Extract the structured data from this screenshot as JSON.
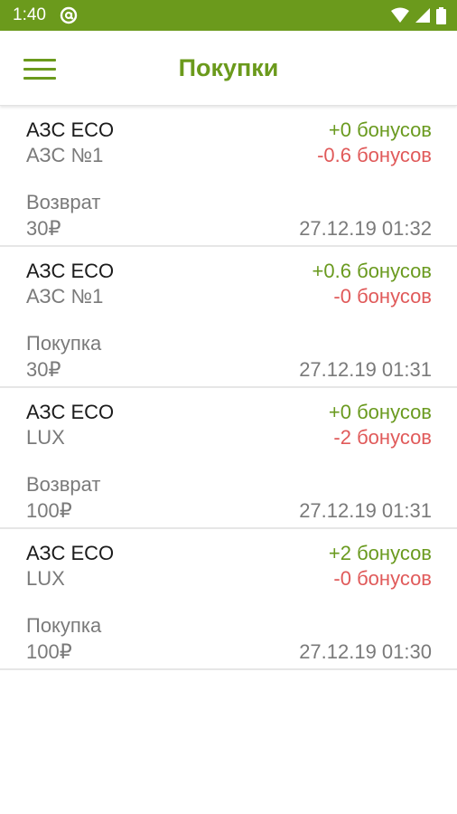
{
  "status_bar": {
    "time": "1:40",
    "icons": [
      "at-icon",
      "wifi-icon",
      "signal-icon",
      "battery-icon"
    ]
  },
  "app_bar": {
    "title": "Покупки",
    "menu_icon": "hamburger-menu-icon"
  },
  "colors": {
    "accent": "#6b9a1c",
    "bonus_plus": "#6a9a1f",
    "bonus_minus": "#e05a5a",
    "secondary_text": "#7a7a7a"
  },
  "purchases": [
    {
      "station": "АЗС ECO",
      "location": "АЗС №1",
      "type": "Возврат",
      "amount": "30₽",
      "bonus_plus": "+0 бонусов",
      "bonus_minus": "-0.6 бонусов",
      "datetime": "27.12.19 01:32"
    },
    {
      "station": "АЗС ECO",
      "location": "АЗС №1",
      "type": "Покупка",
      "amount": "30₽",
      "bonus_plus": "+0.6 бонусов",
      "bonus_minus": "-0 бонусов",
      "datetime": "27.12.19 01:31"
    },
    {
      "station": "АЗС ECO",
      "location": "LUX",
      "type": "Возврат",
      "amount": "100₽",
      "bonus_plus": "+0 бонусов",
      "bonus_minus": "-2 бонусов",
      "datetime": "27.12.19 01:31"
    },
    {
      "station": "АЗС ECO",
      "location": "LUX",
      "type": "Покупка",
      "amount": "100₽",
      "bonus_plus": "+2 бонусов",
      "bonus_minus": "-0 бонусов",
      "datetime": "27.12.19 01:30"
    }
  ]
}
